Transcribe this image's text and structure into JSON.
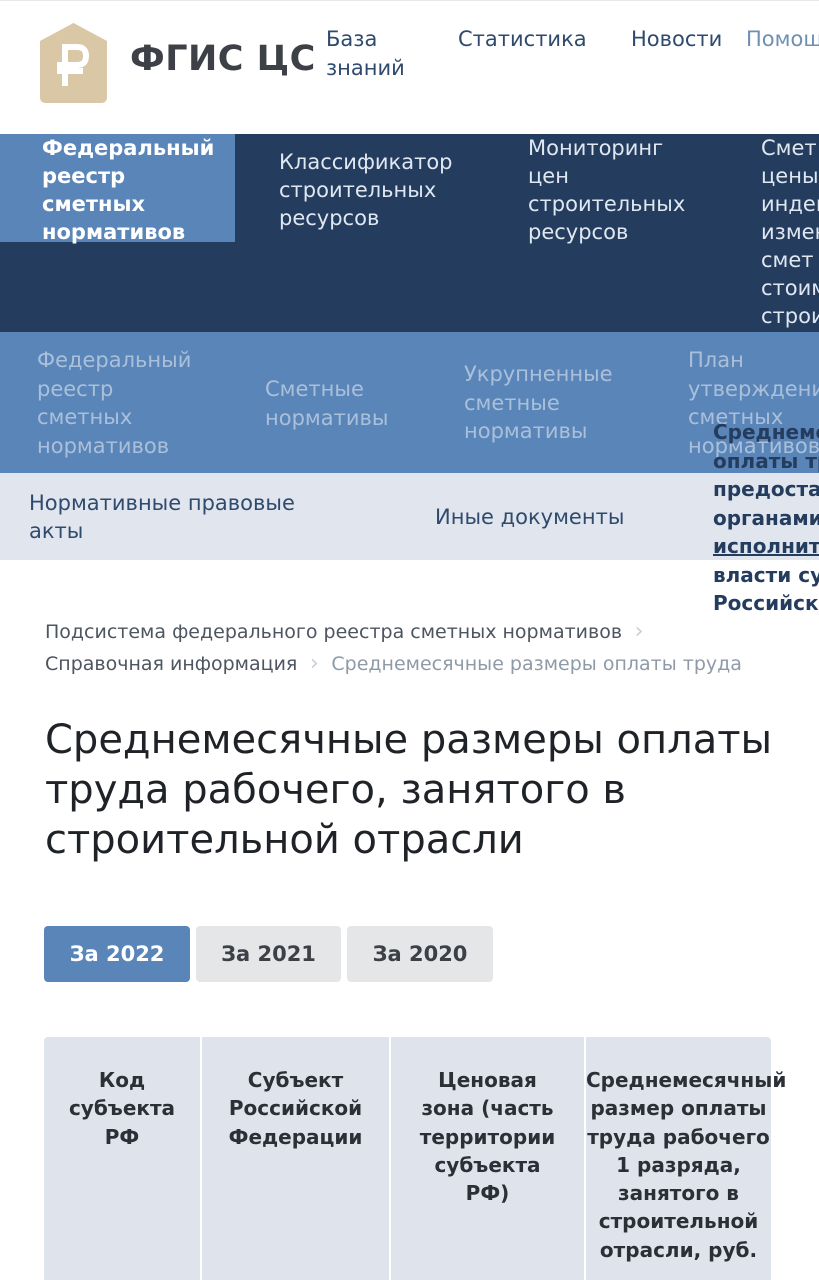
{
  "header": {
    "logo_text": "ФГИС ЦС",
    "top_nav": [
      {
        "line1": "База",
        "line2": "знаний"
      },
      {
        "line1": "Статистика",
        "line2": ""
      },
      {
        "line1": "Новости",
        "line2": ""
      },
      {
        "line1": "Помощ",
        "line2": ""
      }
    ]
  },
  "primary_nav": [
    {
      "lines": [
        "Федеральный",
        "реестр",
        "сметных",
        "нормативов"
      ]
    },
    {
      "lines": [
        "Классификатор",
        "строительных",
        "ресурсов"
      ]
    },
    {
      "lines": [
        "Мониторинг",
        "цен",
        "строительных",
        "ресурсов"
      ]
    },
    {
      "lines": [
        "Смет",
        "цены",
        "индек",
        "измен",
        "смет",
        "стоим",
        "строи"
      ]
    }
  ],
  "secondary_nav": [
    {
      "lines": [
        "Федеральный",
        "реестр",
        "сметных",
        "нормативов"
      ]
    },
    {
      "lines": [
        "Сметные",
        "нормативы"
      ]
    },
    {
      "lines": [
        "Укрупненные",
        "сметные",
        "нормативы"
      ]
    },
    {
      "lines": [
        "План",
        "утверждения",
        "сметных",
        "нормативов"
      ]
    }
  ],
  "tertiary_nav": [
    {
      "lines": [
        "Нормативные правовые",
        "акты"
      ]
    },
    {
      "lines": [
        "Иные документы"
      ]
    }
  ],
  "overflow_menu": {
    "lines": [
      "Среднеме",
      "оплаты тр",
      "предоста",
      "органами",
      "исполнит",
      "власти су",
      "Российско"
    ]
  },
  "breadcrumb": {
    "item1": "Подсистема федерального реестра сметных нормативов",
    "item2": "Справочная информация",
    "current": "Среднемесячные размеры оплаты труда"
  },
  "page": {
    "title": "Среднемесячные размеры оплаты труда рабочего, занятого в строительной отрасли"
  },
  "tabs": [
    "За 2022",
    "За 2021",
    "За 2020"
  ],
  "table": {
    "columns": [
      "Код субъекта РФ",
      "Субъект Российской Федерации",
      "Ценовая зона (часть территории субъекта РФ)",
      "Среднемесячный размер оплаты труда рабочего 1 разряда, занятого в строительной отрасли, руб."
    ]
  },
  "colors": {
    "brand_dark": "#243c5e",
    "brand_mid": "#5a85b8",
    "brand_light": "#e1e6ee",
    "logo_beige": "#d9c7a5"
  },
  "icons": {
    "logo": "ruble-house-icon"
  }
}
